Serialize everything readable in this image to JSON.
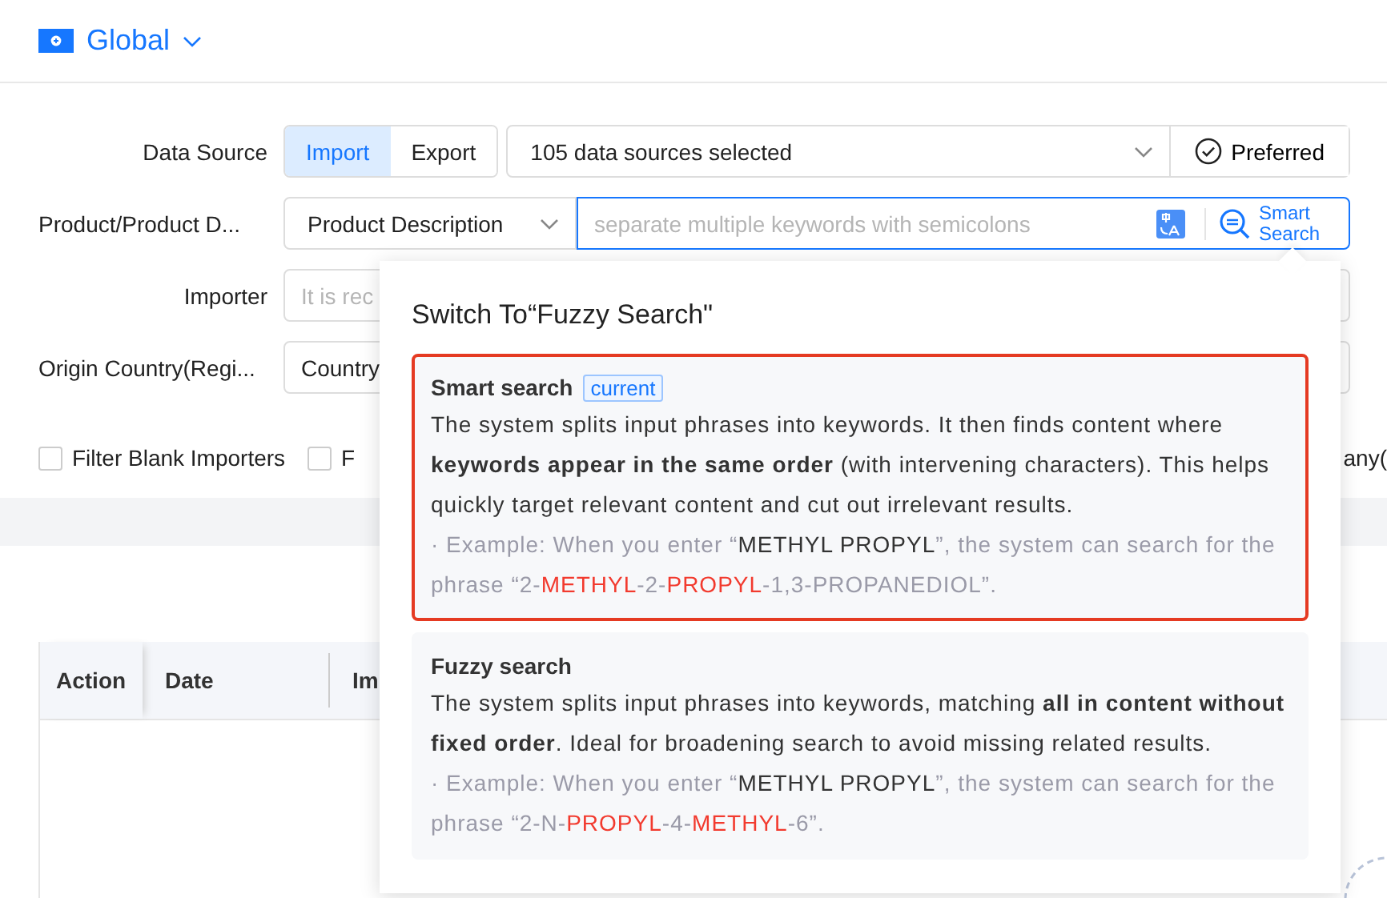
{
  "header": {
    "title": "Global"
  },
  "data_source": {
    "label": "Data Source",
    "options": [
      {
        "label": "Import",
        "selected": true
      },
      {
        "label": "Export",
        "selected": false
      }
    ],
    "select_value": "105 data sources selected",
    "preferred": "Preferred"
  },
  "product": {
    "label": "Product/Product D...",
    "field_select": "Product Description",
    "placeholder": "separate multiple keywords with semicolons",
    "search_mode": "Smart Search"
  },
  "importer": {
    "label": "Importer",
    "placeholder": "It is rec"
  },
  "origin": {
    "label": "Origin Country(Regi...",
    "select_value": "Country"
  },
  "filters": [
    {
      "label": "Filter Blank Importers",
      "checked": false
    },
    {
      "label": "F",
      "checked": false
    }
  ],
  "filter_cut_label": "any(",
  "table": {
    "columns": [
      "Action",
      "Date",
      "Im"
    ]
  },
  "popover": {
    "title": "Switch To“Fuzzy Search\"",
    "options": [
      {
        "name": "Smart search",
        "badge": "current",
        "selected": true,
        "description": "The system splits input phrases into keywords. It then finds content where **keywords appear in the same order** (with intervening characters). This helps quickly target relevant content and cut out irrelevant results.",
        "example": [
          {
            "text": "· Example: When you enter “",
            "quoted": false,
            "highlight": false
          },
          {
            "text": "METHYL PROPYL",
            "quoted": true,
            "highlight": false
          },
          {
            "text": "”, the system can search for the phrase “2-",
            "quoted": false,
            "highlight": false
          },
          {
            "text": "METHYL",
            "quoted": false,
            "highlight": true
          },
          {
            "text": "-2-",
            "quoted": false,
            "highlight": false
          },
          {
            "text": "PROPYL",
            "quoted": false,
            "highlight": true
          },
          {
            "text": "-1,3-PROPANEDIOL”.",
            "quoted": false,
            "highlight": false
          }
        ]
      },
      {
        "name": "Fuzzy search",
        "selected": false,
        "description": "The system splits input phrases into keywords, matching **all in content without fixed order**. Ideal for broadening search to avoid missing related results.",
        "example": [
          {
            "text": "· Example: When you enter “",
            "quoted": false,
            "highlight": false
          },
          {
            "text": "METHYL PROPYL",
            "quoted": true,
            "highlight": false
          },
          {
            "text": "”, the system can search for the phrase “2-N-",
            "quoted": false,
            "highlight": false
          },
          {
            "text": "PROPYL",
            "quoted": false,
            "highlight": true
          },
          {
            "text": "-4-",
            "quoted": false,
            "highlight": false
          },
          {
            "text": "METHYL",
            "quoted": false,
            "highlight": true
          },
          {
            "text": "-6”.",
            "quoted": false,
            "highlight": false
          }
        ]
      }
    ]
  }
}
